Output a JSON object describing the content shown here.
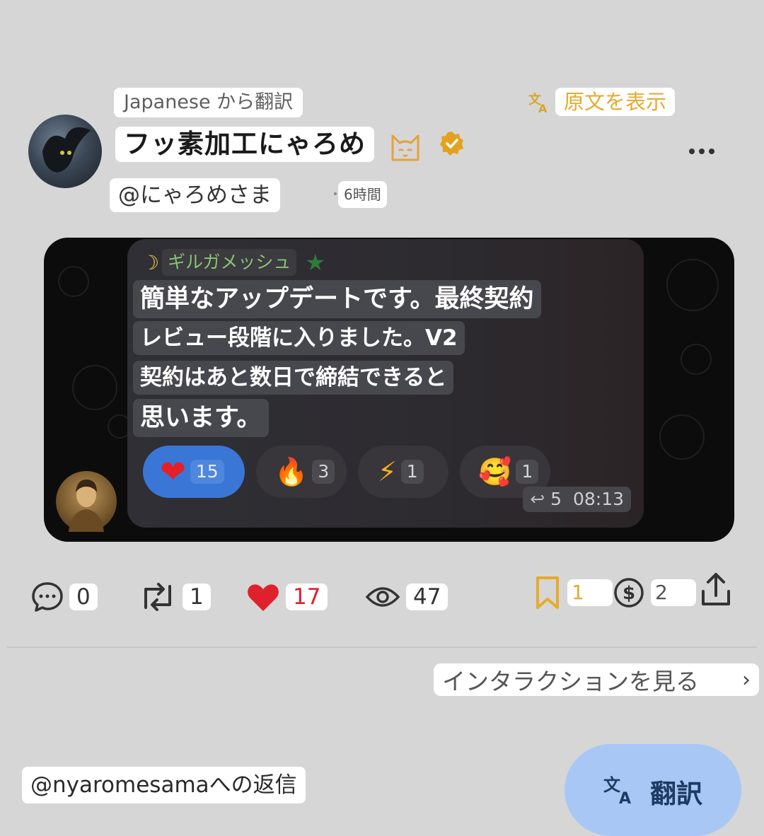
{
  "post": {
    "translated_from": "Japanese から翻訳",
    "show_original": "原文を表示",
    "display_name": "フッ素加工にゃろめ",
    "handle": "@にゃろめさま",
    "time": "6時間"
  },
  "embed": {
    "sender": "ギルガメッシュ",
    "message_lines": [
      "簡単なアップデートです。最終契約",
      "レビュー段階に入りました。V2",
      "契約はあと数日で締結できると",
      "思います。"
    ],
    "reactions": [
      {
        "emoji": "❤",
        "count": "15"
      },
      {
        "emoji": "🔥",
        "count": "3"
      },
      {
        "emoji": "⚡",
        "count": "1"
      },
      {
        "emoji": "🥰",
        "count": "1"
      }
    ],
    "replies": "5",
    "timestamp": "08:13"
  },
  "actions": {
    "comments": "0",
    "reposts": "1",
    "likes": "17",
    "views": "47",
    "bookmarks": "1",
    "tips": "2"
  },
  "interactions_label": "インタラクションを見る",
  "reply_to": "@nyaromesamaへの返信",
  "translate_button": "翻訳",
  "colors": {
    "accent": "#e5ab2e",
    "like": "#e0202c",
    "reaction_selected": "#3a76d6",
    "translate_fab": "#a9c7f4"
  }
}
